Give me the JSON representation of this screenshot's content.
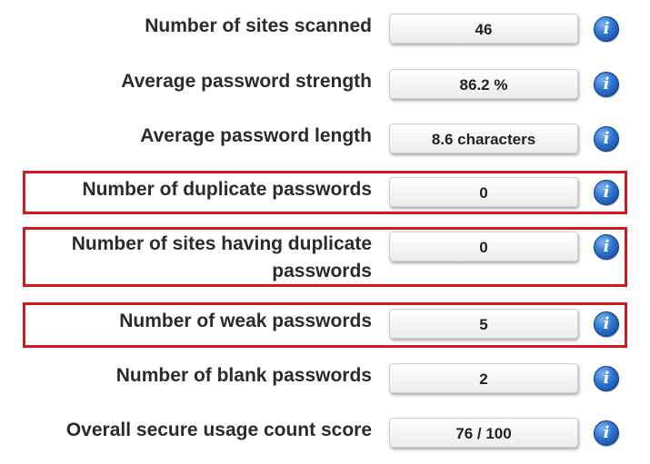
{
  "accent": {
    "highlight": "#d9161c",
    "info": "#2f74d0"
  },
  "icons": {
    "info": "info-icon"
  },
  "stats": [
    {
      "label": "Number of sites scanned",
      "value": "46",
      "highlighted": false
    },
    {
      "label": "Average password strength",
      "value": "86.2 %",
      "highlighted": false
    },
    {
      "label": "Average password length",
      "value": "8.6 characters",
      "highlighted": false
    },
    {
      "label": "Number of duplicate passwords",
      "value": "0",
      "highlighted": true
    },
    {
      "label_line1": "Number of sites having duplicate",
      "label_line2": "passwords",
      "value": "0",
      "highlighted": true
    },
    {
      "label": "Number of weak passwords",
      "value": "5",
      "highlighted": true
    },
    {
      "label": "Number of blank passwords",
      "value": "2",
      "highlighted": false
    },
    {
      "label": "Overall secure usage count score",
      "value": "76 / 100",
      "highlighted": false
    }
  ],
  "info_glyph": "i"
}
